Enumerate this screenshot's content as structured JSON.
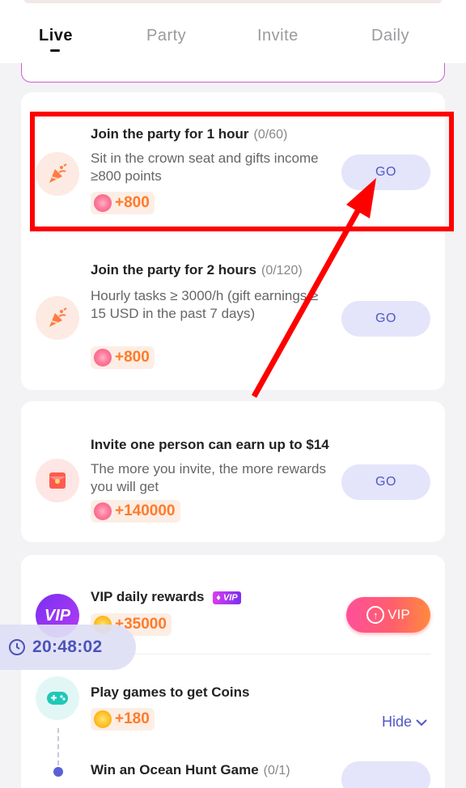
{
  "tabs": [
    {
      "label": "Live",
      "active": true
    },
    {
      "label": "Party",
      "active": false
    },
    {
      "label": "Invite",
      "active": false
    },
    {
      "label": "Daily",
      "active": false
    }
  ],
  "tasks": [
    {
      "title": "Join the party for 1 hour",
      "progress": "(0/60)",
      "desc": "Sit in the crown seat and gifts income ≥800 points",
      "reward": "+800",
      "button": "GO",
      "icon": "party-popper-icon"
    },
    {
      "title": "Join the party for 2 hours",
      "progress": "(0/120)",
      "desc": "Hourly tasks ≥ 3000/h (gift earnings ≥ 15 USD in the past 7 days)",
      "reward": "+800",
      "button": "GO",
      "icon": "party-popper-icon"
    },
    {
      "title": "Invite one person can earn up to $14",
      "progress": "",
      "desc": "The more you invite, the more rewards you will get",
      "reward": "+140000",
      "button": "GO",
      "icon": "red-envelope-icon"
    }
  ],
  "vip": {
    "icon_text": "VIP",
    "title": "VIP daily rewards",
    "badge": "VIP",
    "reward": "+35000",
    "button": "VIP"
  },
  "games": {
    "title": "Play games to get Coins",
    "reward": "+180",
    "hide": "Hide"
  },
  "ocean": {
    "title": "Win an Ocean Hunt Game",
    "progress": "(0/1)"
  },
  "timer": {
    "time": "20:48:02"
  },
  "colors": {
    "accent": "#5158c4",
    "reward_orange": "#ff7b29",
    "highlight_red": "#ff0000"
  }
}
